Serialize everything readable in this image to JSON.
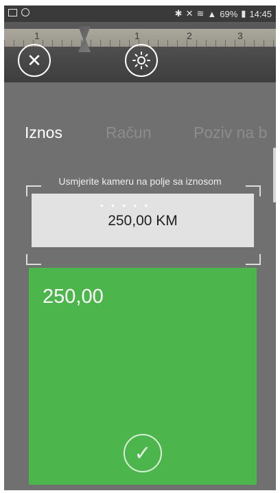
{
  "status_bar": {
    "battery": "69%",
    "time": "14:45",
    "icons_left": [
      "picture-icon",
      "whatsapp-icon"
    ],
    "icons_right": [
      "bluetooth-icon",
      "mute-icon",
      "wifi-icon",
      "signal-icon",
      "battery-icon"
    ]
  },
  "camera": {
    "ruler_numbers": [
      "1",
      "1",
      "2",
      "3"
    ],
    "close_icon": "close-icon",
    "flash_icon": "brightness-icon"
  },
  "tabs": [
    {
      "label": "Iznos",
      "active": true
    },
    {
      "label": "Račun",
      "active": false
    },
    {
      "label": "Poziv na b",
      "active": false
    }
  ],
  "scanner": {
    "hint": "Usmjerite kameru na polje sa iznosom",
    "captured_text": "250,00 KM"
  },
  "result": {
    "value": "250,00",
    "confirm_icon": "check-icon"
  },
  "colors": {
    "result_green": "#4cb64c",
    "background_gray": "#707070",
    "active_tab": "#ffffff",
    "inactive_tab": "#8d8d8d"
  }
}
